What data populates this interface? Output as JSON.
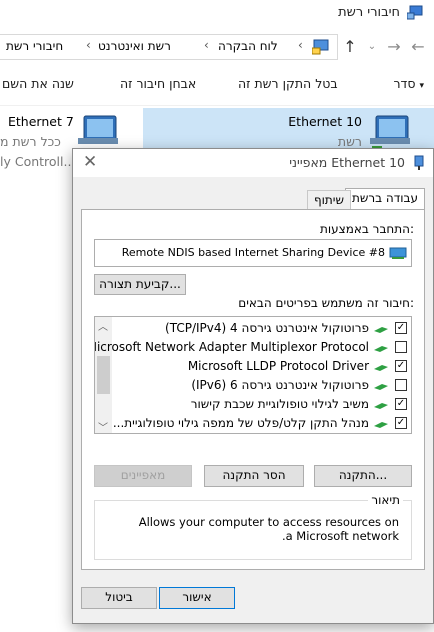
{
  "explorer": {
    "window_title": "חיבורי רשת",
    "address": {
      "segments": [
        "לוח הבקרה",
        "רשת ואינטרנט",
        "חיבורי רשת"
      ]
    },
    "commands": [
      "סדר",
      "בטל התקן רשת זה",
      "אבחן חיבור זה",
      "שנה את השם"
    ],
    "cards": {
      "ethernet10": {
        "name": "Ethernet 10",
        "sub": "רשת"
      },
      "ethernet7": {
        "name": "Ethernet 7",
        "sub": "ככל רשת מ",
        "sub2": "ly Controll..."
      }
    }
  },
  "dialog": {
    "title": "מאפייני Ethernet 10",
    "tabs": [
      "עבודה ברשת",
      "שיתוף"
    ],
    "connect_using_label": "התחבר באמצעות:",
    "device_name": "Remote NDIS based Internet Sharing Device #8",
    "configure_button": "קביעת תצורה...",
    "items_label": "חיבור זה משתמש בפריטים הבאים:",
    "items": [
      {
        "label": "(TCP/IPv4) פרוטוקול אינטרנט גירסה 4",
        "checked": true
      },
      {
        "label": "Microsoft Network Adapter Multiplexor Protocol",
        "checked": false
      },
      {
        "label": "Microsoft LLDP Protocol Driver",
        "checked": true
      },
      {
        "label": "(IPv6) פרוטוקול אינטרנט גירסה 6",
        "checked": false
      },
      {
        "label": "משיב לגילוי טופולוגיית שכבת קישור",
        "checked": true
      },
      {
        "label": "...מנהל התקן קלט/פלט של ממפה גילוי טופולוגיית",
        "checked": true
      }
    ],
    "install_button": "התקנה...",
    "uninstall_button": "הסר התקנה",
    "properties_button": "מאפיינים",
    "description_legend": "תיאור",
    "description_text": "Allows your computer to access resources on a Microsoft network.",
    "ok_button": "אישור",
    "cancel_button": "ביטול"
  }
}
